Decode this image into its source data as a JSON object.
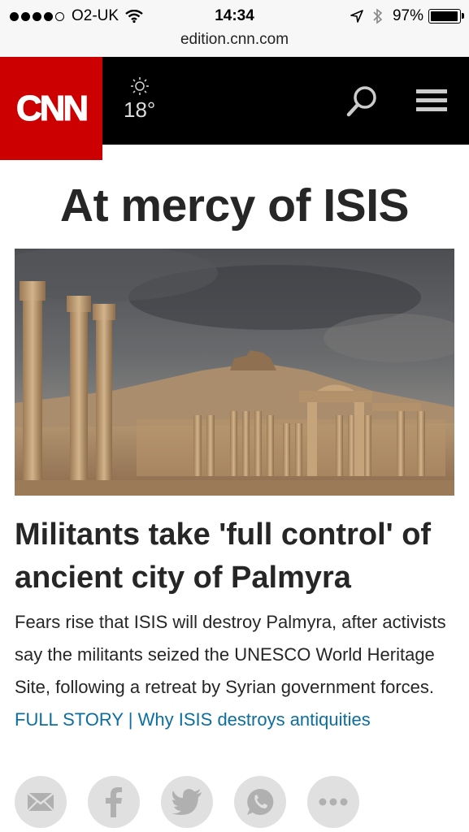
{
  "status_bar": {
    "carrier": "O2-UK",
    "time": "14:34",
    "battery_percent": "97%",
    "battery_level": 0.97
  },
  "browser": {
    "url": "edition.cnn.com"
  },
  "header": {
    "logo": "CNN",
    "weather_icon": "sun-icon",
    "temperature": "18°",
    "brand_color": "#cc0000"
  },
  "page": {
    "headline": "At mercy of ISIS",
    "story": {
      "title": "Militants take 'full control' of ancient city of Palmyra",
      "body": "Fears rise that ISIS will destroy Palmyra, after activists say the militants seized the UNESCO World Heritage Site, following a retreat by Syrian government forces. ",
      "full_story_link": "FULL STORY",
      "separator": " | ",
      "related_link": "Why ISIS destroys antiquities",
      "link_color": "#0c6ea0"
    }
  },
  "share_icons": [
    "email-icon",
    "facebook-icon",
    "twitter-icon",
    "whatsapp-icon",
    "more-icon"
  ]
}
